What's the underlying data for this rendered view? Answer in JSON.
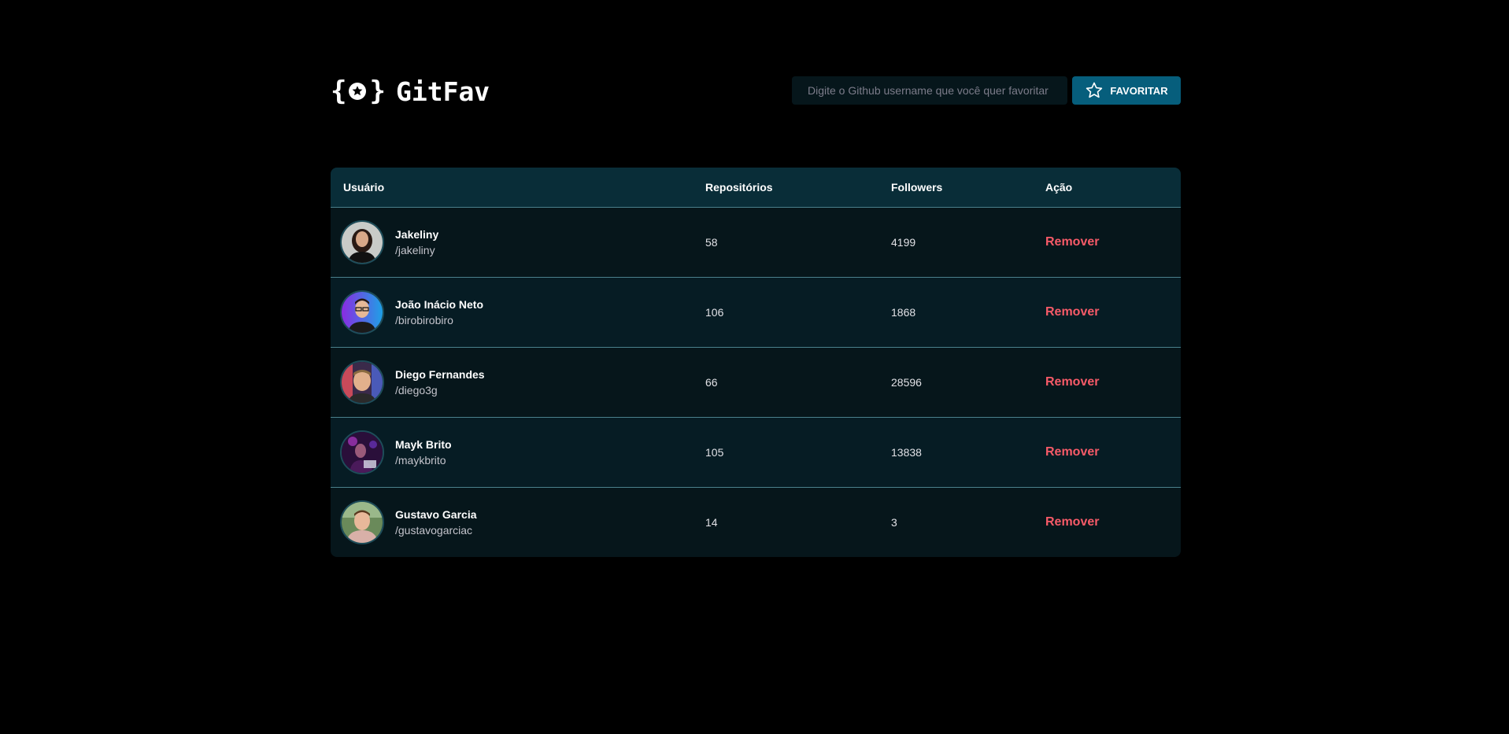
{
  "app": {
    "brand_name": "GitFav",
    "logo_icon": "star-braces-icon"
  },
  "search": {
    "placeholder": "Digite o Github username que você quer favoritar",
    "value": "",
    "button_label": "FAVORITAR",
    "button_icon": "star-outline-icon",
    "button_color": "#065e7c"
  },
  "table": {
    "headers": {
      "user": "Usuário",
      "repos": "Repositórios",
      "followers": "Followers",
      "action": "Ação"
    },
    "rows": [
      {
        "name": "Jakeliny",
        "login": "/jakeliny",
        "repos": "58",
        "followers": "4199",
        "action": "Remover",
        "avatar_icon": "avatar-photo"
      },
      {
        "name": "João Inácio Neto",
        "login": "/birobirobiro",
        "repos": "106",
        "followers": "1868",
        "action": "Remover",
        "avatar_icon": "avatar-photo"
      },
      {
        "name": "Diego Fernandes",
        "login": "/diego3g",
        "repos": "66",
        "followers": "28596",
        "action": "Remover",
        "avatar_icon": "avatar-photo"
      },
      {
        "name": "Mayk Brito",
        "login": "/maykbrito",
        "repos": "105",
        "followers": "13838",
        "action": "Remover",
        "avatar_icon": "avatar-photo"
      },
      {
        "name": "Gustavo Garcia",
        "login": "/gustavogarciac",
        "repos": "14",
        "followers": "3",
        "action": "Remover",
        "avatar_icon": "avatar-photo"
      }
    ]
  },
  "colors": {
    "background": "#000000",
    "header_row": "#092d38",
    "row_odd": "#06161b",
    "row_even": "#061c24",
    "remove_text": "#f75a68",
    "accent": "#065e7c"
  }
}
